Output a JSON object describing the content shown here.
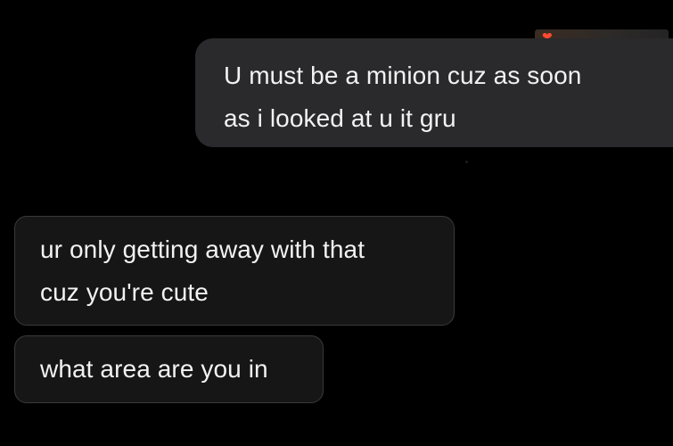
{
  "messages": [
    {
      "direction": "outgoing",
      "lines": [
        "U must be a minion cuz as soon",
        "as i looked at u it gru"
      ]
    },
    {
      "direction": "incoming",
      "lines": [
        "ur only getting away with that",
        "cuz you're cute"
      ]
    },
    {
      "direction": "incoming",
      "lines": [
        "what area are you in"
      ]
    }
  ],
  "reaction": {
    "icon": "heart-icon",
    "glyph": "❤"
  },
  "colors": {
    "background": "#000000",
    "outgoing_bubble": "#2a2a2c",
    "incoming_bubble": "#161616",
    "incoming_border": "#3a3a3a",
    "text": "#f2f2f2",
    "reaction_heart": "#ff4a2f"
  }
}
